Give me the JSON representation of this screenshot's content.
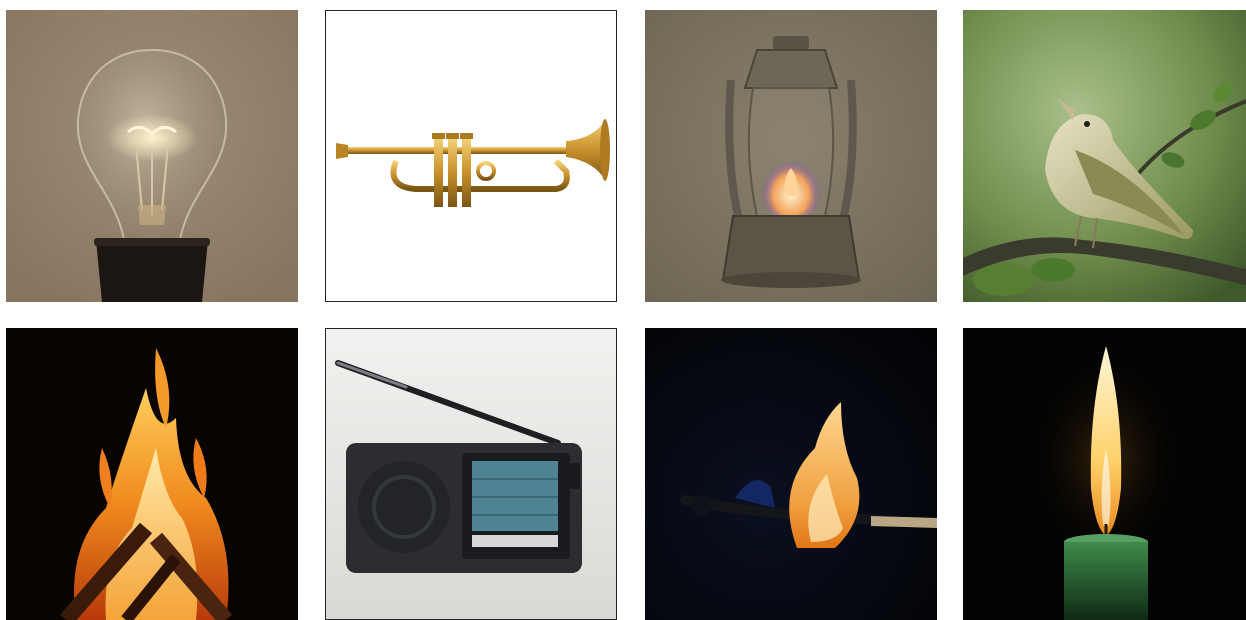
{
  "grid": {
    "tiles": [
      {
        "subject": "light-bulb"
      },
      {
        "subject": "trumpet"
      },
      {
        "subject": "oil-lantern"
      },
      {
        "subject": "songbird"
      },
      {
        "subject": "campfire"
      },
      {
        "subject": "radio"
      },
      {
        "subject": "burning-match"
      },
      {
        "subject": "candle"
      }
    ]
  }
}
